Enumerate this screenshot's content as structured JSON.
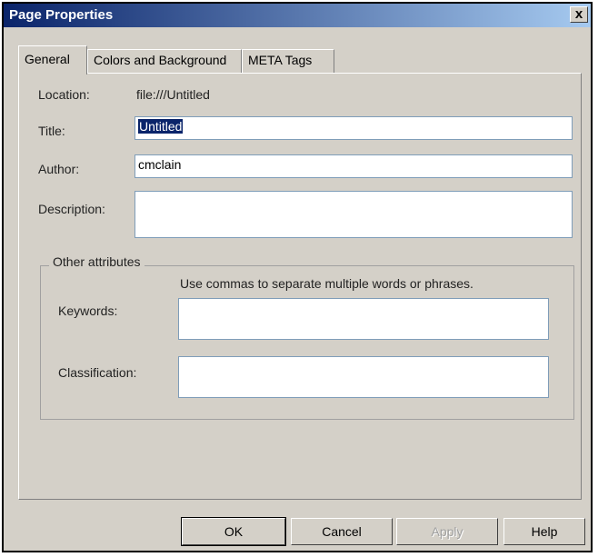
{
  "window": {
    "title": "Page Properties",
    "close_glyph": "x"
  },
  "tabs": [
    {
      "label": "General",
      "active": true
    },
    {
      "label": "Colors and Background",
      "active": false
    },
    {
      "label": "META Tags",
      "active": false
    }
  ],
  "general": {
    "location_label": "Location:",
    "location_value": "file:///Untitled",
    "title_label": "Title:",
    "title_value": "Untitled",
    "author_label": "Author:",
    "author_value": "cmclain",
    "description_label": "Description:",
    "description_value": ""
  },
  "other_attributes": {
    "group_title": "Other attributes",
    "hint": "Use commas to separate multiple words or phrases.",
    "keywords_label": "Keywords:",
    "keywords_value": "",
    "classification_label": "Classification:",
    "classification_value": ""
  },
  "buttons": {
    "ok": "OK",
    "cancel": "Cancel",
    "apply": "Apply",
    "help": "Help"
  }
}
